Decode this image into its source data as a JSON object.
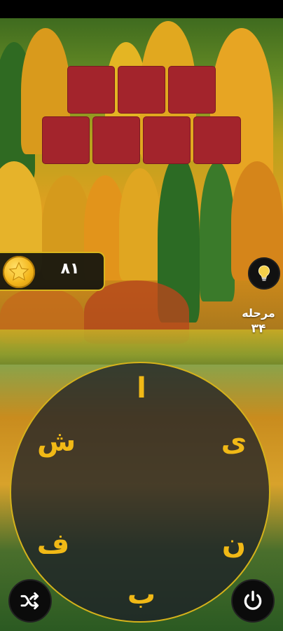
{
  "coins": {
    "value": "۸۱"
  },
  "level": {
    "label": "مرحله",
    "number": "۳۴"
  },
  "word_grid": {
    "rows": [
      {
        "tiles": 3
      },
      {
        "tiles": 4
      }
    ]
  },
  "wheel_letters": [
    "ا",
    "ی",
    "ن",
    "ب",
    "ف",
    "ش"
  ],
  "icons": {
    "coin": "star-coin-icon",
    "hint": "lightbulb-icon",
    "shuffle": "shuffle-icon",
    "exit": "power-icon"
  },
  "colors": {
    "tile": "#a3242c",
    "accent": "#f1b916",
    "wheel_border": "#d5b21b"
  }
}
